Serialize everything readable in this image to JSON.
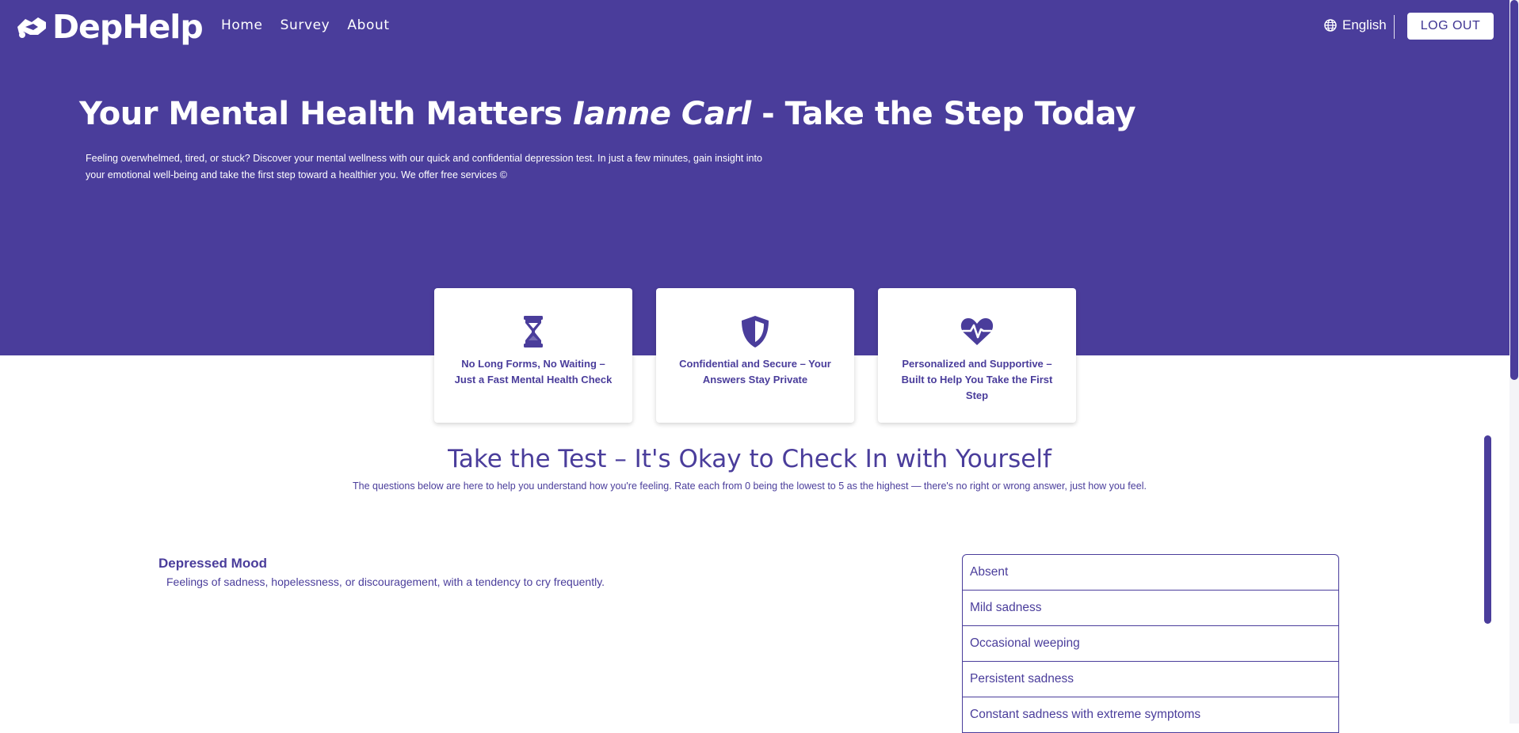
{
  "brand": {
    "name": "DepHelp",
    "logo_icon": "handshake-icon"
  },
  "nav": [
    {
      "label": "Home"
    },
    {
      "label": "Survey"
    },
    {
      "label": "About"
    }
  ],
  "language": {
    "label": "English",
    "icon": "globe-icon"
  },
  "logout_label": "LOG OUT",
  "hero": {
    "title_prefix": "Your Mental Health Matters ",
    "user_name": "Ianne Carl",
    "title_suffix": " - Take the Step Today",
    "description": "Feeling overwhelmed, tired, or stuck? Discover your mental wellness with our quick and confidential depression test. In just a few minutes, gain insight into your emotional well-being and take the first step toward a healthier you. We offer free services ©"
  },
  "features": [
    {
      "icon": "hourglass-icon",
      "text": "No Long Forms, No Waiting – Just a Fast Mental Health Check"
    },
    {
      "icon": "shield-icon",
      "text": "Confidential and Secure – Your Answers Stay Private"
    },
    {
      "icon": "heart-pulse-icon",
      "text": "Personalized and Supportive – Built to Help You Take the First Step"
    }
  ],
  "test": {
    "title": "Take the Test – It's Okay to Check In with Yourself",
    "subtitle": "The questions below are here to help you understand how you're feeling. Rate each from 0 being the lowest to 5 as the highest — there's no right or wrong answer, just how you feel."
  },
  "question": {
    "title": "Depressed Mood",
    "description": "Feelings of sadness, hopelessness, or discouragement, with a tendency to cry frequently.",
    "options": [
      "Absent",
      "Mild sadness",
      "Occasional weeping",
      "Persistent sadness",
      "Constant sadness with extreme symptoms"
    ]
  },
  "colors": {
    "primary": "#4a3d9b",
    "background": "#ffffff"
  }
}
